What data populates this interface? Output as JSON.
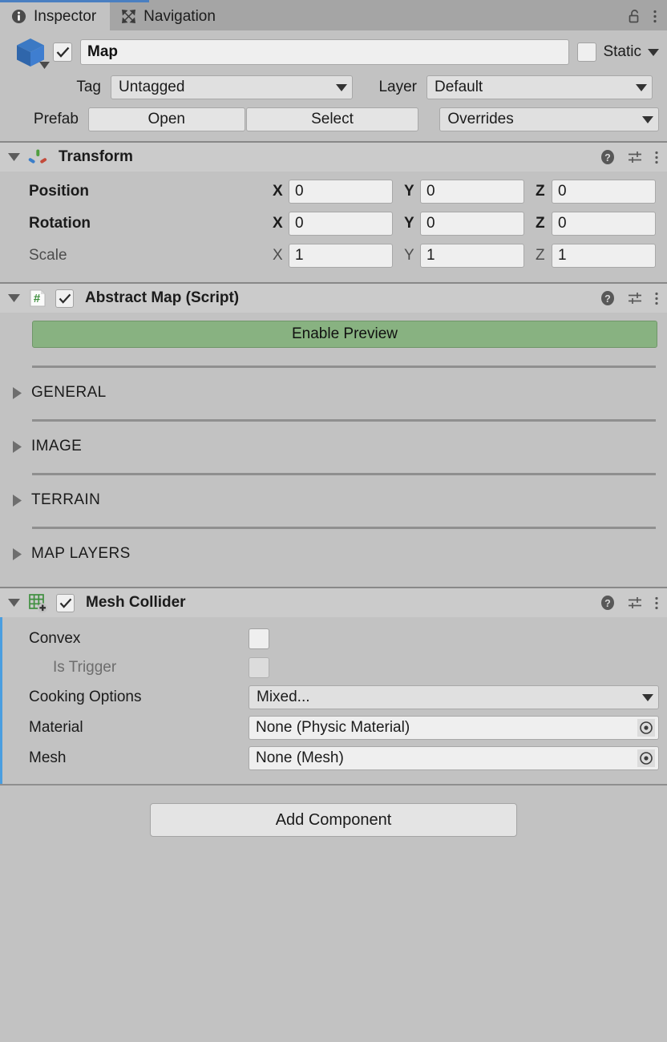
{
  "window": {
    "tabs": [
      {
        "label": "Inspector",
        "icon": "info-icon",
        "active": true
      },
      {
        "label": "Navigation",
        "icon": "navigation-move-icon",
        "active": false
      }
    ],
    "lock_icon": "lock-open-icon",
    "menu_icon": "kebab-menu-icon",
    "accent_color": "#4a7fc1",
    "background_color": "#c2c2c2"
  },
  "object_header": {
    "icon": "gameobject-cube-icon",
    "enabled_checkbox": true,
    "name": "Map",
    "static_label": "Static",
    "static_checked": false,
    "tag_label": "Tag",
    "tag_value": "Untagged",
    "layer_label": "Layer",
    "layer_value": "Default",
    "prefab_label": "Prefab",
    "prefab_open": "Open",
    "prefab_select": "Select",
    "overrides_value": "Overrides"
  },
  "components": [
    {
      "id": "transform",
      "title": "Transform",
      "icon": "transform-axis-icon",
      "expanded": true,
      "has_checkbox": false,
      "selected": false,
      "help_icon": "help-icon",
      "preset_icon": "preset-sliders-icon",
      "menu_icon": "kebab-menu-icon",
      "rows": [
        {
          "label": "Position",
          "style": "bold",
          "axes": [
            "X",
            "Y",
            "Z"
          ],
          "values": [
            "0",
            "0",
            "0"
          ]
        },
        {
          "label": "Rotation",
          "style": "bold",
          "axes": [
            "X",
            "Y",
            "Z"
          ],
          "values": [
            "0",
            "0",
            "0"
          ]
        },
        {
          "label": "Scale",
          "style": "dim",
          "axes": [
            "X",
            "Y",
            "Z"
          ],
          "values": [
            "1",
            "1",
            "1"
          ]
        }
      ]
    },
    {
      "id": "abstract-map",
      "title": "Abstract Map (Script)",
      "icon": "script-hash-icon",
      "expanded": true,
      "has_checkbox": true,
      "checkbox_checked": true,
      "selected": false,
      "help_icon": "help-icon",
      "preset_icon": "preset-sliders-icon",
      "menu_icon": "kebab-menu-icon",
      "preview_button": "Enable Preview",
      "preview_button_color": "#88b281",
      "foldouts": [
        {
          "label": "GENERAL",
          "expanded": false
        },
        {
          "label": "IMAGE",
          "expanded": false
        },
        {
          "label": "TERRAIN",
          "expanded": false
        },
        {
          "label": "MAP LAYERS",
          "expanded": false
        }
      ]
    },
    {
      "id": "mesh-collider",
      "title": "Mesh Collider",
      "icon": "mesh-collider-grid-icon",
      "expanded": true,
      "has_checkbox": true,
      "checkbox_checked": true,
      "selected": true,
      "selection_color": "#4a9ee0",
      "help_icon": "help-icon",
      "preset_icon": "preset-sliders-icon",
      "menu_icon": "kebab-menu-icon",
      "fields": [
        {
          "label": "Convex",
          "type": "checkbox",
          "checked": false,
          "disabled": false
        },
        {
          "label": "Is Trigger",
          "type": "checkbox",
          "checked": false,
          "disabled": true
        },
        {
          "label": "Cooking Options",
          "type": "dropdown",
          "value": "Mixed..."
        },
        {
          "label": "Material",
          "type": "object",
          "value": "None (Physic Material)"
        },
        {
          "label": "Mesh",
          "type": "object",
          "value": "None (Mesh)"
        }
      ]
    }
  ],
  "footer": {
    "add_component_label": "Add Component"
  }
}
